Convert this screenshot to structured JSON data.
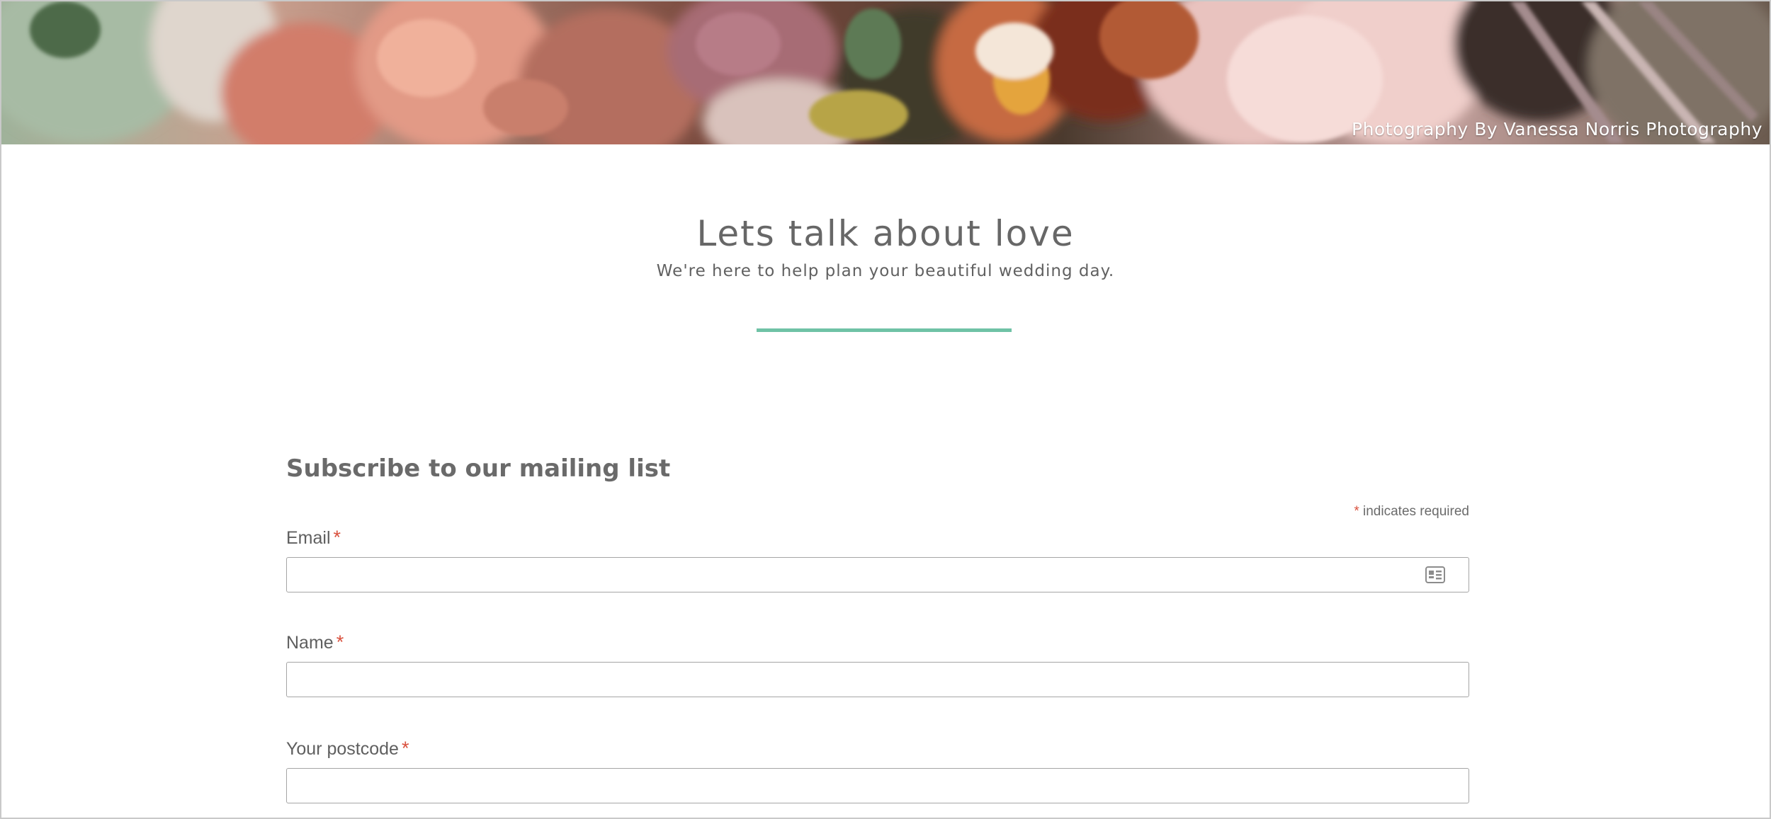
{
  "hero": {
    "photo_credit": "Photography By Vanessa Norris Photography"
  },
  "intro": {
    "title": "Lets talk about love",
    "subtitle": "We're here to help plan your beautiful wedding day."
  },
  "colors": {
    "accent_divider": "#6fc2a6",
    "required_asterisk": "#d9513e",
    "text": "#5f5f5f"
  },
  "form": {
    "heading": "Subscribe to our mailing list",
    "required_marker": "*",
    "required_note": "indicates required",
    "fields": [
      {
        "label": "Email",
        "value": "",
        "icon": "contact-card-icon"
      },
      {
        "label": "Name",
        "value": ""
      },
      {
        "label": "Your postcode",
        "value": ""
      }
    ]
  }
}
